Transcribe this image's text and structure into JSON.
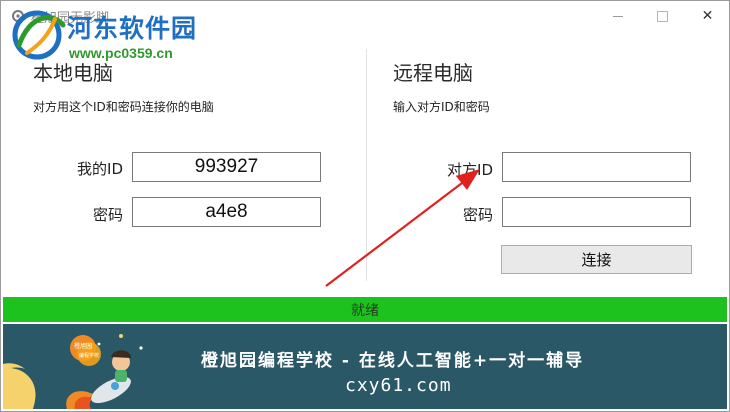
{
  "window": {
    "title": "橙旭园无影脚",
    "min_glyph": "",
    "max_glyph": "",
    "close_glyph": "✕"
  },
  "watermark": {
    "logo_text": "河东软件园",
    "url": "www.pc0359.cn"
  },
  "local": {
    "title": "本地电脑",
    "subtitle": "对方用这个ID和密码连接你的电脑",
    "id_label": "我的ID",
    "id_value": "993927",
    "password_label": "密码",
    "password_value": "a4e8"
  },
  "remote": {
    "title": "远程电脑",
    "subtitle": "输入对方ID和密码",
    "id_label": "对方ID",
    "id_value": "",
    "password_label": "密码",
    "password_value": "",
    "connect_label": "连接"
  },
  "status": {
    "text": "就绪",
    "color": "#1ec21e"
  },
  "banner": {
    "line1": "橙旭园编程学校 - 在线人工智能+一对一辅导",
    "line2": "cxy61.com",
    "badge_text": "橙旭园",
    "badge_sub": "编程学校",
    "background": "#2b5867"
  },
  "colors": {
    "watermark_blue": "#1f6fc2",
    "watermark_green": "#2e9a2e",
    "arrow": "#e0211f"
  }
}
